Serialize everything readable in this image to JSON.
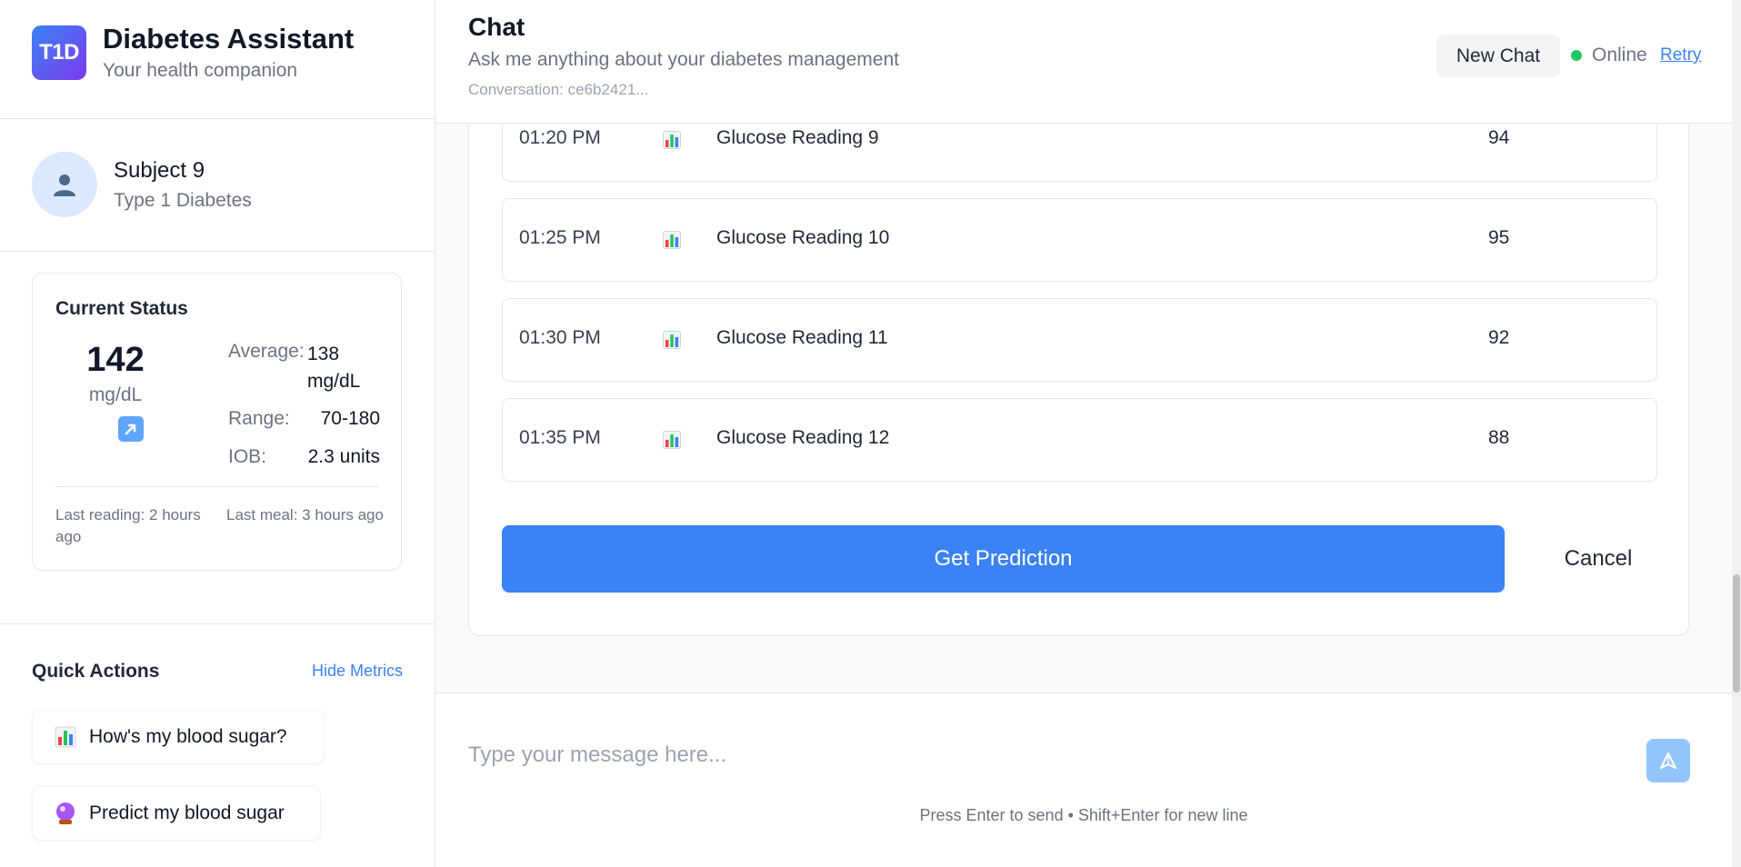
{
  "brand": {
    "logo_text": "T1D",
    "title": "Diabetes Assistant",
    "subtitle": "Your health companion"
  },
  "profile": {
    "name": "Subject 9",
    "type": "Type 1 Diabetes"
  },
  "status": {
    "title": "Current Status",
    "glucose_value": "142",
    "glucose_unit": "mg/dL",
    "trend_icon": "arrow-up-right-icon",
    "average_label": "Average:",
    "average_value": "138 mg/dL",
    "range_label": "Range:",
    "range_value": "70-180",
    "iob_label": "IOB:",
    "iob_value": "2.3 units",
    "last_reading": "Last reading: 2 hours ago",
    "last_meal": "Last meal: 3 hours ago"
  },
  "quick_actions": {
    "title": "Quick Actions",
    "toggle_label": "Hide Metrics",
    "items": [
      {
        "icon": "bar-chart-icon",
        "label": "How's my blood sugar?"
      },
      {
        "icon": "crystal-ball-icon",
        "label": "Predict my blood sugar"
      }
    ]
  },
  "header": {
    "title": "Chat",
    "subtitle": "Ask me anything about your diabetes management",
    "conversation": "Conversation: ce6b2421...",
    "new_chat_label": "New Chat",
    "status_label": "Online",
    "retry_label": "Retry",
    "status_color": "#22c55e"
  },
  "readings": [
    {
      "time": "01:20 PM",
      "icon": "bar-chart-icon",
      "name": "Glucose Reading 9",
      "value": "94"
    },
    {
      "time": "01:25 PM",
      "icon": "bar-chart-icon",
      "name": "Glucose Reading 10",
      "value": "95"
    },
    {
      "time": "01:30 PM",
      "icon": "bar-chart-icon",
      "name": "Glucose Reading 11",
      "value": "92"
    },
    {
      "time": "01:35 PM",
      "icon": "bar-chart-icon",
      "name": "Glucose Reading 12",
      "value": "88"
    }
  ],
  "actions": {
    "predict_label": "Get Prediction",
    "cancel_label": "Cancel",
    "accent_color": "#3b82f6"
  },
  "composer": {
    "placeholder": "Type your message here...",
    "hint": "Press Enter to send • Shift+Enter for new line",
    "send_icon": "send-icon"
  }
}
